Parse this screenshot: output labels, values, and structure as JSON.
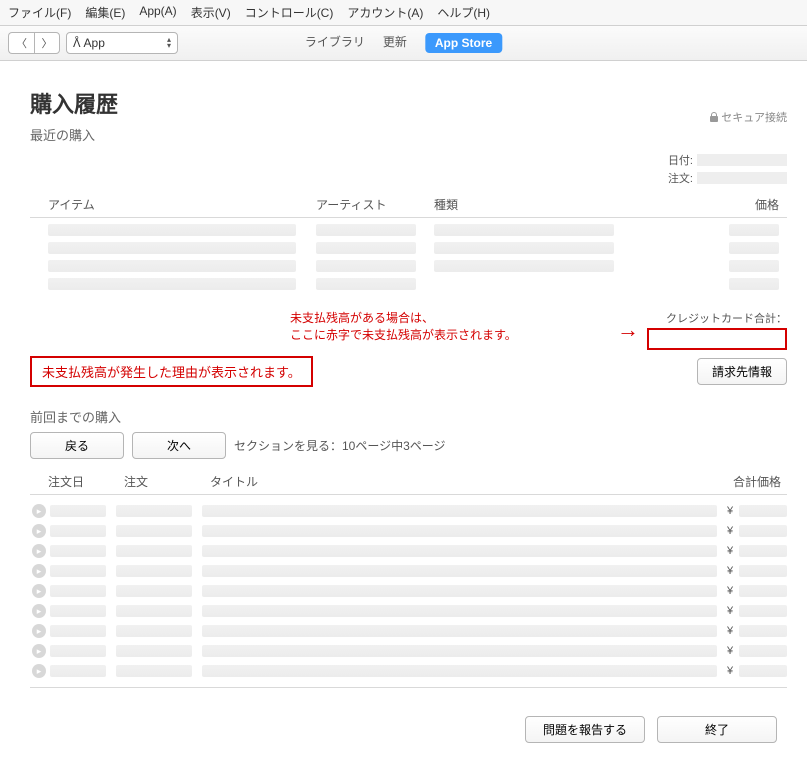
{
  "menu": {
    "file": "ファイル(F)",
    "edit": "編集(E)",
    "app": "App(A)",
    "view": "表示(V)",
    "control": "コントロール(C)",
    "account": "アカウント(A)",
    "help": "ヘルプ(H)"
  },
  "toolbar": {
    "category_label": "App",
    "tab_library": "ライブラリ",
    "tab_updates": "更新",
    "tab_store": "App Store"
  },
  "header": {
    "title": "購入履歴",
    "secure_label": "セキュア接続",
    "subtitle": "最近の購入"
  },
  "order_meta": {
    "date_label": "日付:",
    "order_label": "注文:"
  },
  "items": {
    "col_item": "アイテム",
    "col_artist": "アーティスト",
    "col_kind": "種類",
    "col_price": "価格"
  },
  "credit": {
    "label": "クレジットカード合計：",
    "annotation_line1": "未支払残高がある場合は、",
    "annotation_line2": "ここに赤字で未支払残高が表示されます。",
    "arrow_glyph": "→"
  },
  "reason": {
    "text": "未支払残高が発生した理由が表示されます。",
    "billing_button": "請求先情報"
  },
  "previous": {
    "title": "前回までの購入",
    "back": "戻る",
    "next": "次へ",
    "section_text": "セクションを見る：10ページ中3ページ",
    "col_date": "注文日",
    "col_order": "注文",
    "col_title": "タイトル",
    "col_total": "合計価格",
    "yen": "¥",
    "row_count": 9
  },
  "footer": {
    "report": "問題を報告する",
    "done": "終了"
  }
}
